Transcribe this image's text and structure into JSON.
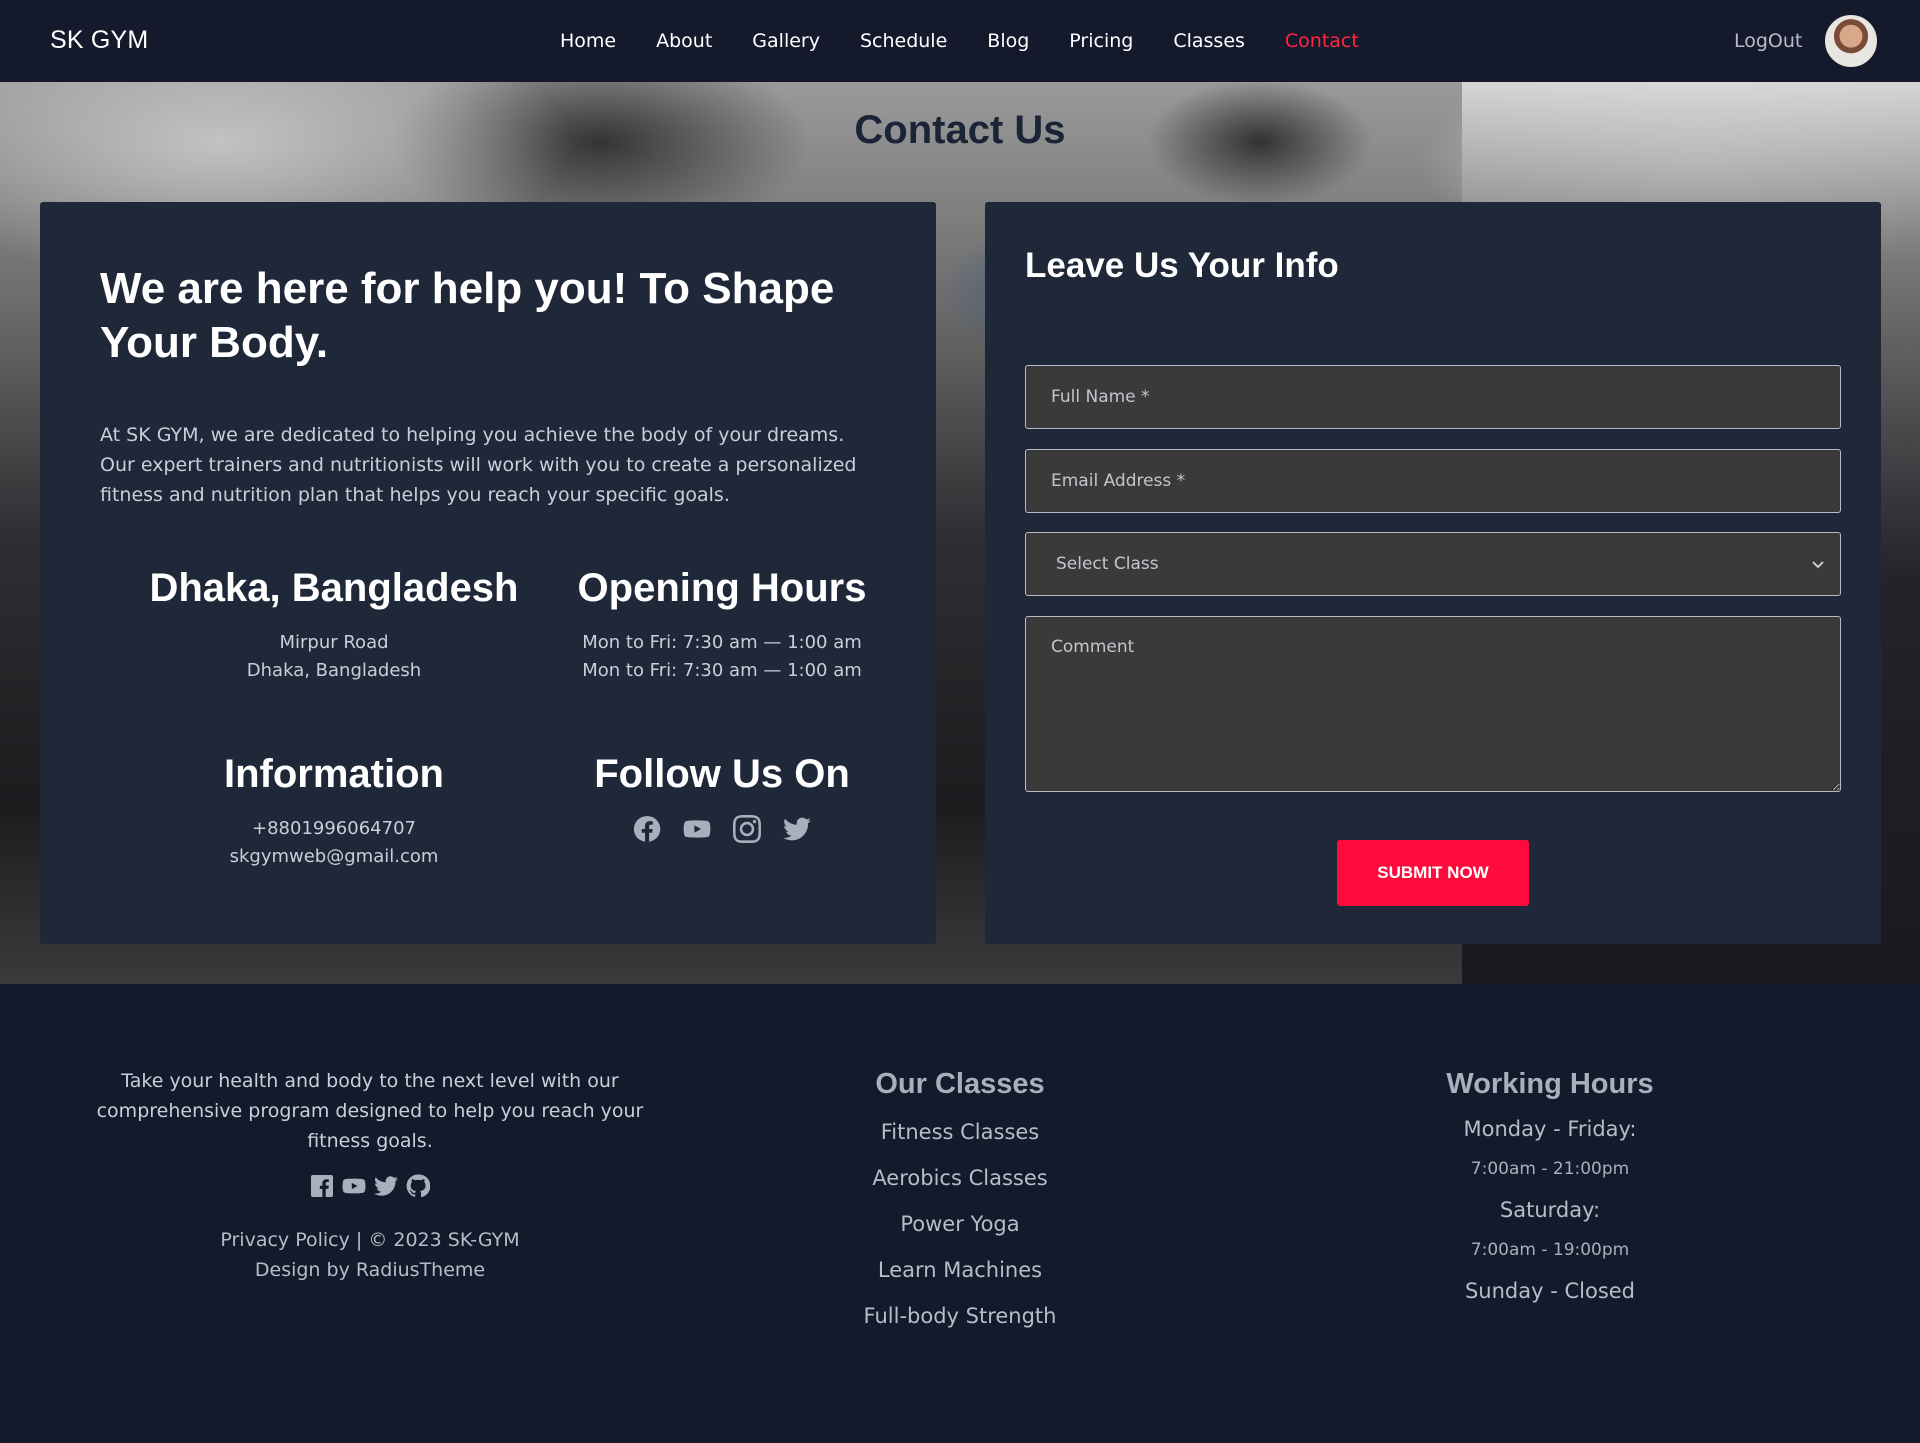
{
  "nav": {
    "brand": "SK GYM",
    "links": [
      "Home",
      "About",
      "Gallery",
      "Schedule",
      "Blog",
      "Pricing",
      "Classes",
      "Contact"
    ],
    "active": "Contact",
    "logout": "LogOut"
  },
  "hero": {
    "title": "Contact Us"
  },
  "info_card": {
    "heading": "We are here for help you! To Shape Your Body.",
    "description": "At SK GYM, we are dedicated to helping you achieve the body of your dreams. Our expert trainers and nutritionists will work with you to create a personalized fitness and nutrition plan that helps you reach your specific goals.",
    "location": {
      "title": "Dhaka, Bangladesh",
      "line1": "Mirpur Road",
      "line2": "Dhaka, Bangladesh"
    },
    "hours": {
      "title": "Opening Hours",
      "line1": "Mon to Fri: 7:30 am — 1:00 am",
      "line2": "Mon to Fri: 7:30 am — 1:00 am"
    },
    "information": {
      "title": "Information",
      "phone": "+8801996064707",
      "email": "skgymweb@gmail.com"
    },
    "follow": {
      "title": "Follow Us On",
      "icons": [
        "facebook-icon",
        "youtube-icon",
        "instagram-icon",
        "twitter-icon"
      ]
    }
  },
  "form": {
    "title": "Leave Us Your Info",
    "full_name_placeholder": "Full Name *",
    "email_placeholder": "Email Address *",
    "select_label": "Select Class",
    "comment_placeholder": "Comment",
    "submit_label": "SUBMIT NOW"
  },
  "footer": {
    "about": "Take your health and body to the next level with our comprehensive program designed to help you reach your fitness goals.",
    "icons": [
      "facebook-square-icon",
      "youtube-icon",
      "twitter-icon",
      "github-icon"
    ],
    "copyright": "Privacy Policy | © 2023 SK-GYM",
    "credit": "Design by RadiusTheme",
    "classes": {
      "heading": "Our Classes",
      "items": [
        "Fitness Classes",
        "Aerobics Classes",
        "Power Yoga",
        "Learn Machines",
        "Full-body Strength"
      ]
    },
    "working_hours": {
      "heading": "Working Hours",
      "weekday_label": "Monday - Friday:",
      "weekday_time": "7:00am - 21:00pm",
      "saturday_label": "Saturday:",
      "saturday_time": "7:00am - 19:00pm",
      "sunday_label": "Sunday - Closed"
    }
  },
  "colors": {
    "nav_bg": "#141a2c",
    "card_bg": "#1f2839",
    "accent": "#ff0a3c",
    "active_link": "#ff2640",
    "footer_bg": "#131a2b"
  }
}
